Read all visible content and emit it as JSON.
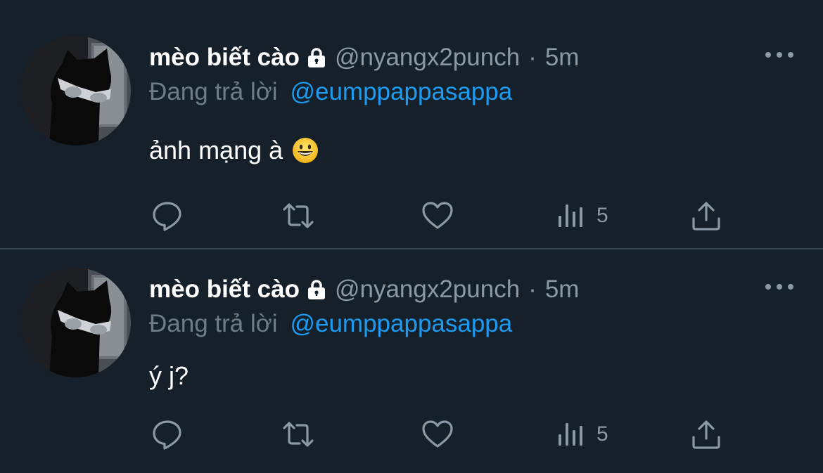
{
  "colors": {
    "background": "#15202b",
    "divider": "#38444d",
    "text_primary": "#ffffff",
    "text_secondary": "#8b98a5",
    "link": "#1d9bf0"
  },
  "tweets": [
    {
      "display_name": "mèo biết cào",
      "lock_icon": "lock-icon",
      "handle": "@nyangx2punch",
      "separator": "·",
      "time": "5m",
      "reply_prefix": "Đang trả lời",
      "reply_to": "@eumppappasappa",
      "text": "ảnh mạng à",
      "emoji": "grinning-face-emoji",
      "views": "5",
      "icons": [
        "reply-icon",
        "retweet-icon",
        "like-icon",
        "views-icon",
        "share-icon"
      ]
    },
    {
      "display_name": "mèo biết cào",
      "lock_icon": "lock-icon",
      "handle": "@nyangx2punch",
      "separator": "·",
      "time": "5m",
      "reply_prefix": "Đang trả lời",
      "reply_to": "@eumppappasappa",
      "text": "ý j?",
      "views": "5",
      "icons": [
        "reply-icon",
        "retweet-icon",
        "like-icon",
        "views-icon",
        "share-icon"
      ]
    }
  ]
}
